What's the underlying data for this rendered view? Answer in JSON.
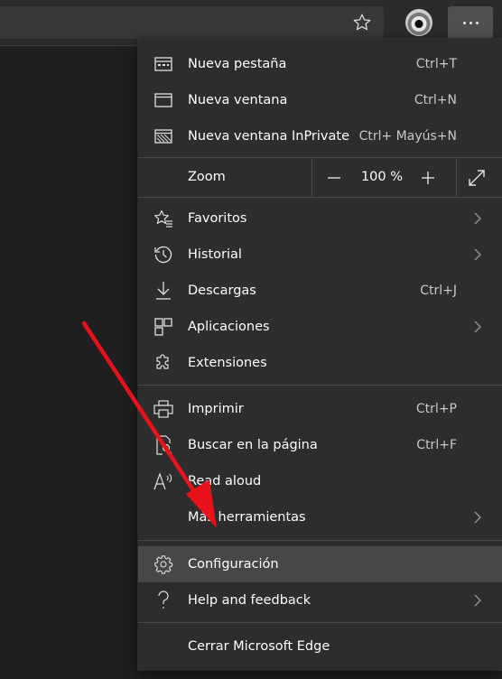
{
  "colors": {
    "arrow": "#e8121b",
    "highlight": "#474747",
    "menu_bg": "#2d2d2d"
  },
  "toolbar": {
    "favorite_icon": "star-outline-icon",
    "avatar_icon": "profile-avatar",
    "more_icon": "ellipsis-icon"
  },
  "menu": {
    "new_tab": {
      "label": "Nueva pestaña",
      "shortcut": "Ctrl+T",
      "icon": "new-tab-icon"
    },
    "new_window": {
      "label": "Nueva ventana",
      "shortcut": "Ctrl+N",
      "icon": "window-icon"
    },
    "new_private": {
      "label": "Nueva ventana InPrivate",
      "shortcut": "Ctrl+ Mayús+N",
      "icon": "inprivate-icon"
    },
    "zoom": {
      "label": "Zoom",
      "value": "100 %",
      "minus_icon": "minus-icon",
      "plus_icon": "plus-icon",
      "fullscreen_icon": "fullscreen-icon"
    },
    "favorites": {
      "label": "Favoritos",
      "icon": "favorites-icon"
    },
    "history": {
      "label": "Historial",
      "icon": "history-icon"
    },
    "downloads": {
      "label": "Descargas",
      "shortcut": "Ctrl+J",
      "icon": "download-icon"
    },
    "apps": {
      "label": "Aplicaciones",
      "icon": "apps-icon"
    },
    "extensions": {
      "label": "Extensiones",
      "icon": "puzzle-icon"
    },
    "print": {
      "label": "Imprimir",
      "shortcut": "Ctrl+P",
      "icon": "printer-icon"
    },
    "find": {
      "label": "Buscar en la página",
      "shortcut": "Ctrl+F",
      "icon": "find-icon"
    },
    "read_aloud": {
      "label": "Read aloud",
      "icon": "read-aloud-icon"
    },
    "more_tools": {
      "label": "Más herramientas"
    },
    "settings": {
      "label": "Configuración",
      "icon": "gear-icon"
    },
    "help": {
      "label": "Help and feedback",
      "icon": "question-icon"
    },
    "close": {
      "label": "Cerrar Microsoft Edge"
    }
  }
}
